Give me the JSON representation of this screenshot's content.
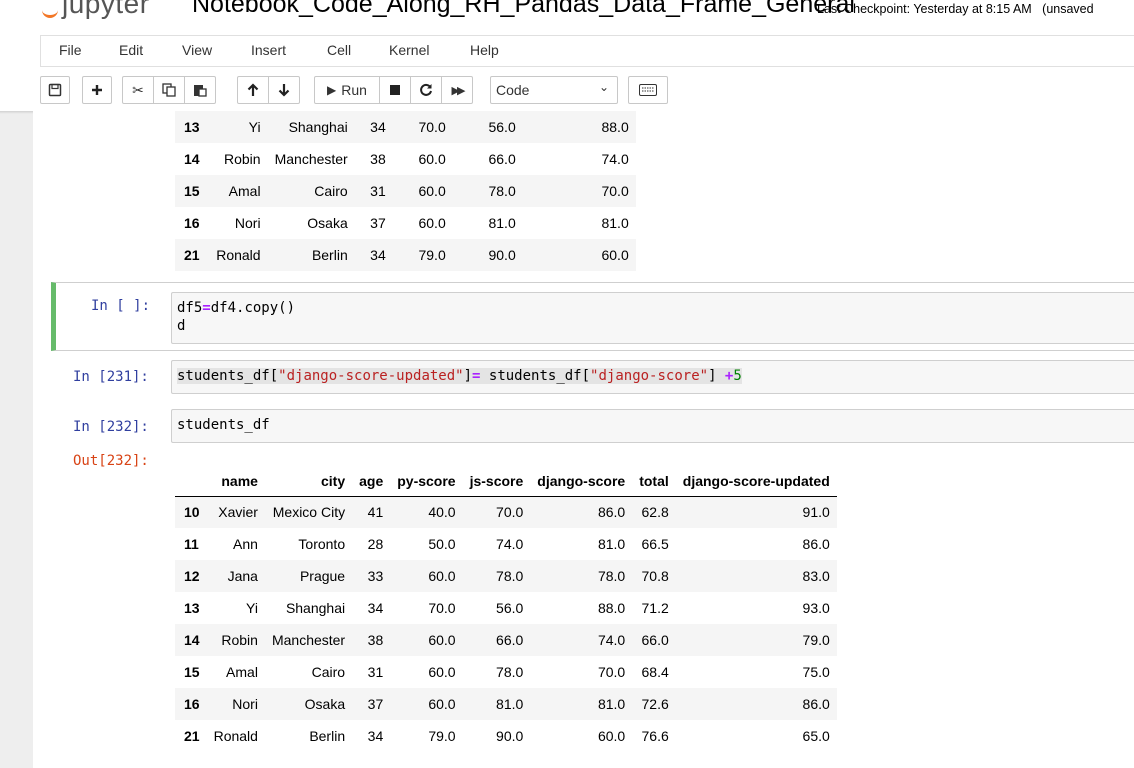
{
  "header": {
    "logo_text": "jupyter",
    "notebook_name": "Notebook_Code_Along_RH_Pandas_Data_Frame_General",
    "checkpoint": "Last Checkpoint: Yesterday at 8:15 AM",
    "unsaved": "(unsaved"
  },
  "menu": [
    "File",
    "Edit",
    "View",
    "Insert",
    "Cell",
    "Kernel",
    "Help"
  ],
  "toolbar": {
    "run_label": "Run",
    "cell_type": "Code",
    "icons": [
      "save-icon",
      "plus-icon",
      "cut-icon",
      "copy-icon",
      "paste-icon",
      "arrow-up-icon",
      "arrow-down-icon",
      "play-icon",
      "stop-icon",
      "restart-icon",
      "fast-forward-icon",
      "keyboard-icon"
    ]
  },
  "top_table": {
    "rows": [
      [
        "13",
        "Yi",
        "Shanghai",
        "34",
        "70.0",
        "56.0",
        "88.0"
      ],
      [
        "14",
        "Robin",
        "Manchester",
        "38",
        "60.0",
        "66.0",
        "74.0"
      ],
      [
        "15",
        "Amal",
        "Cairo",
        "31",
        "60.0",
        "78.0",
        "70.0"
      ],
      [
        "16",
        "Nori",
        "Osaka",
        "37",
        "60.0",
        "81.0",
        "81.0"
      ],
      [
        "21",
        "Ronald",
        "Berlin",
        "34",
        "79.0",
        "90.0",
        "60.0"
      ]
    ]
  },
  "cells": [
    {
      "prompt": "In [ ]:",
      "code_line1_a": "df5",
      "code_line1_b": "=",
      "code_line1_c": "df4.copy()",
      "code_line2": "d"
    },
    {
      "prompt": "In [231]:",
      "c1": "students_df[",
      "c2": "\"django-score-updated\"",
      "c3": "]",
      "c4": "=",
      "c5": " students_df[",
      "c6": "\"django-score\"",
      "c7": "] ",
      "c8": "+",
      "c9": "5"
    },
    {
      "prompt": "In [232]:",
      "code": "students_df"
    }
  ],
  "output": {
    "prompt": "Out[232]:",
    "columns": [
      "",
      "name",
      "city",
      "age",
      "py-score",
      "js-score",
      "django-score",
      "total",
      "django-score-updated"
    ],
    "rows": [
      [
        "10",
        "Xavier",
        "Mexico City",
        "41",
        "40.0",
        "70.0",
        "86.0",
        "62.8",
        "91.0"
      ],
      [
        "11",
        "Ann",
        "Toronto",
        "28",
        "50.0",
        "74.0",
        "81.0",
        "66.5",
        "86.0"
      ],
      [
        "12",
        "Jana",
        "Prague",
        "33",
        "60.0",
        "78.0",
        "78.0",
        "70.8",
        "83.0"
      ],
      [
        "13",
        "Yi",
        "Shanghai",
        "34",
        "70.0",
        "56.0",
        "88.0",
        "71.2",
        "93.0"
      ],
      [
        "14",
        "Robin",
        "Manchester",
        "38",
        "60.0",
        "66.0",
        "74.0",
        "66.0",
        "79.0"
      ],
      [
        "15",
        "Amal",
        "Cairo",
        "31",
        "60.0",
        "78.0",
        "70.0",
        "68.4",
        "75.0"
      ],
      [
        "16",
        "Nori",
        "Osaka",
        "37",
        "60.0",
        "81.0",
        "81.0",
        "72.6",
        "86.0"
      ],
      [
        "21",
        "Ronald",
        "Berlin",
        "34",
        "79.0",
        "90.0",
        "60.0",
        "76.6",
        "65.0"
      ]
    ]
  }
}
